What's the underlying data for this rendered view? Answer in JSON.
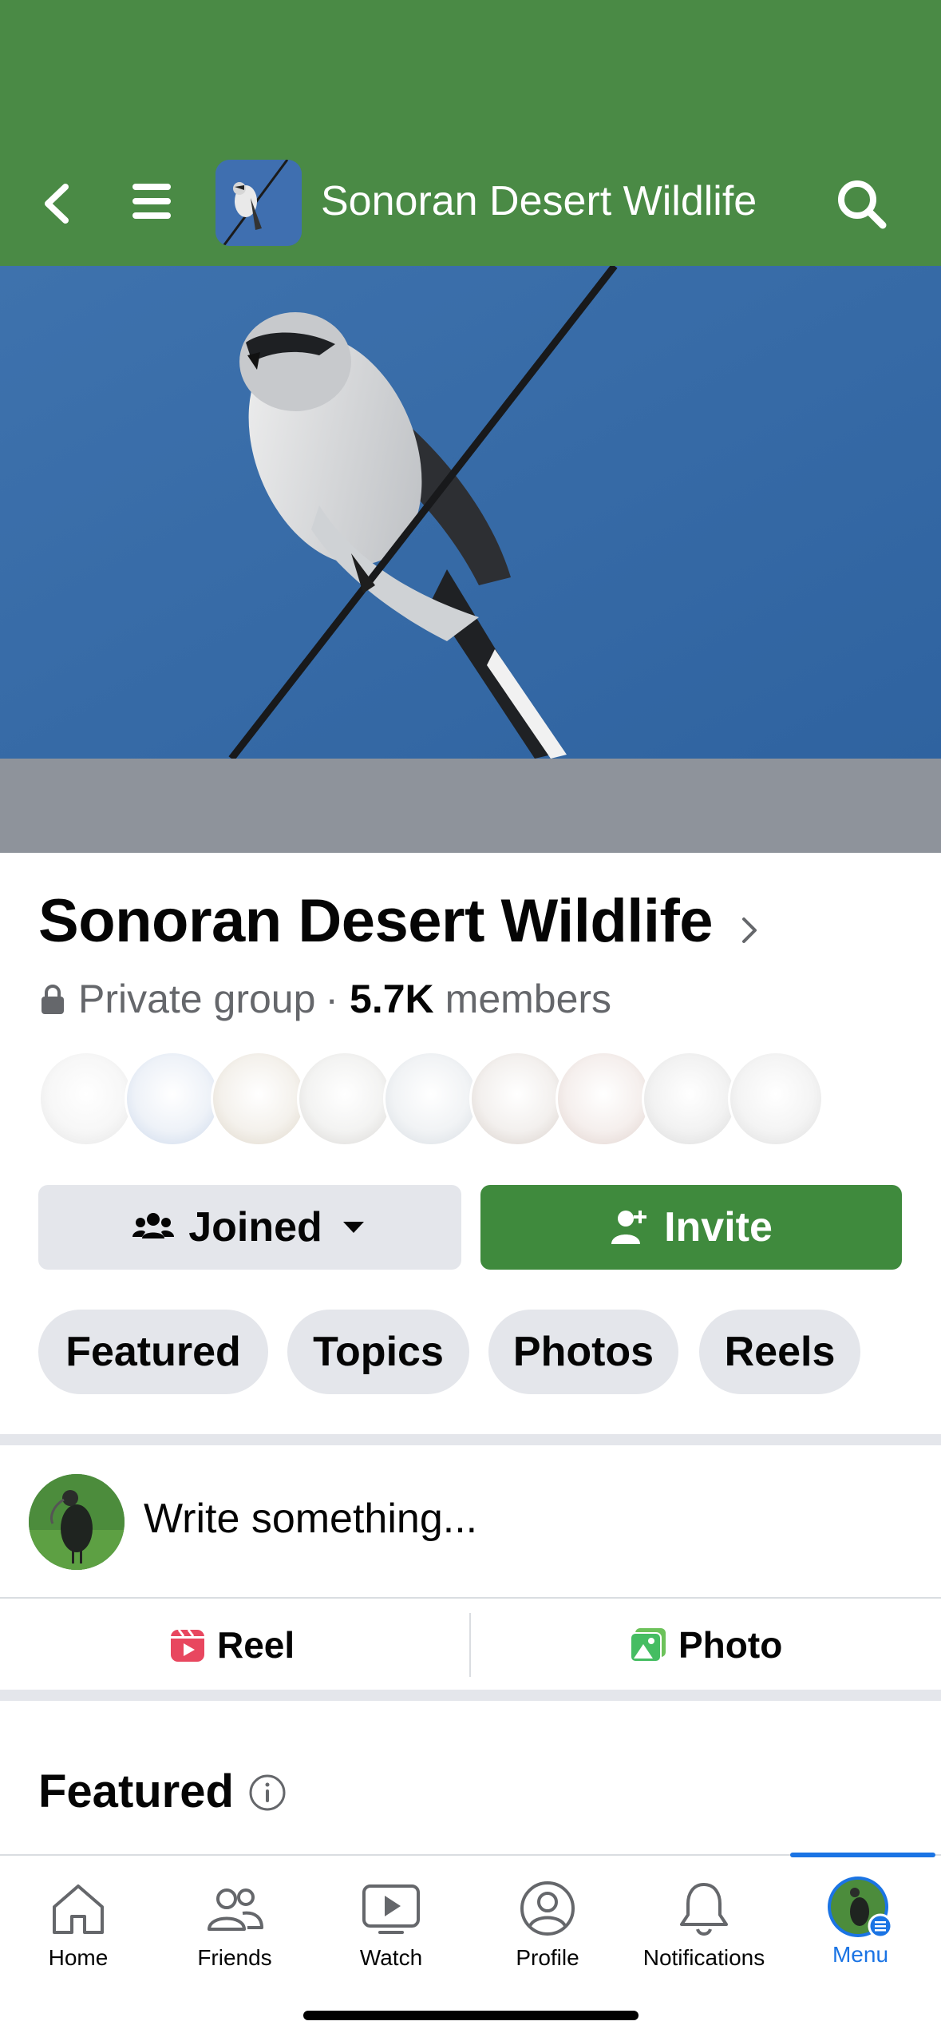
{
  "header": {
    "title": "Sonoran Desert Wildlife",
    "back_icon": "chevron-left-icon",
    "menu_icon": "hamburger-icon",
    "search_icon": "search-icon",
    "background_color": "#4a8a45"
  },
  "group": {
    "name": "Sonoran Desert Wildlife",
    "privacy": "Private group",
    "separator": "·",
    "member_count": "5.7K",
    "members_label": "members"
  },
  "actions": {
    "joined_label": "Joined",
    "invite_label": "Invite",
    "invite_color": "#3f8a3d"
  },
  "chips": [
    {
      "label": "Featured"
    },
    {
      "label": "Topics"
    },
    {
      "label": "Photos"
    },
    {
      "label": "Reels"
    }
  ],
  "composer": {
    "placeholder": "Write something..."
  },
  "post_actions": {
    "reel_label": "Reel",
    "photo_label": "Photo"
  },
  "featured": {
    "title": "Featured"
  },
  "bottom_nav": {
    "items": [
      {
        "label": "Home",
        "icon": "home-icon"
      },
      {
        "label": "Friends",
        "icon": "friends-icon"
      },
      {
        "label": "Watch",
        "icon": "watch-icon"
      },
      {
        "label": "Profile",
        "icon": "profile-icon"
      },
      {
        "label": "Notifications",
        "icon": "bell-icon"
      },
      {
        "label": "Menu",
        "icon": "menu-avatar-icon",
        "active": true
      }
    ],
    "active_color": "#1b74e4"
  }
}
